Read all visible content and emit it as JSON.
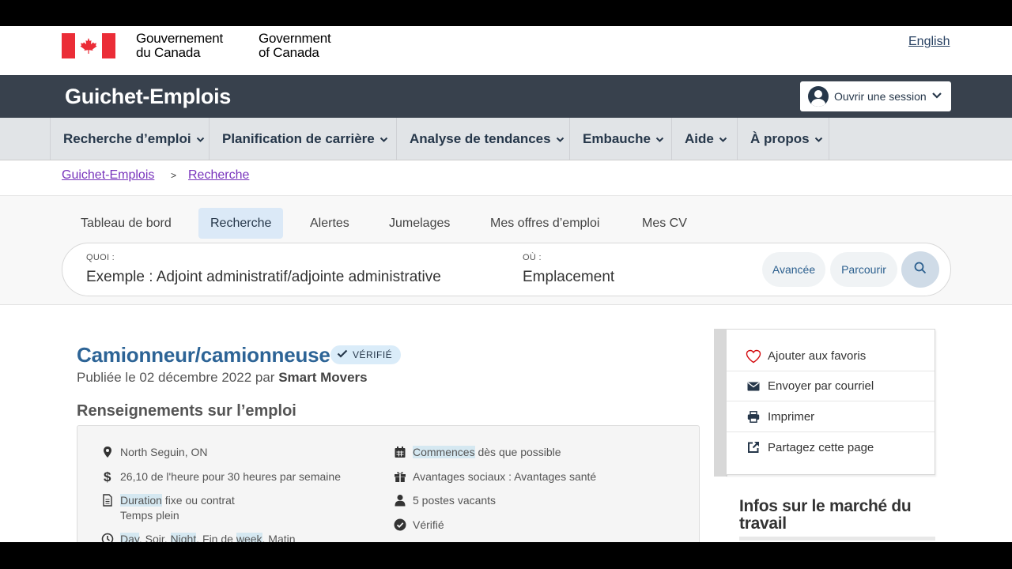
{
  "goc": {
    "name_fr_line1": "Gouvernement",
    "name_fr_line2": "du Canada",
    "name_en_line1": "Government",
    "name_en_line2": "of Canada",
    "language_link": "English"
  },
  "app": {
    "title": "Guichet-Emplois",
    "login_label": "Ouvrir une session"
  },
  "nav": {
    "items": [
      "Recherche d’emploi",
      "Planification de carrière",
      "Analyse de tendances",
      "Embauche",
      "Aide",
      "À propos"
    ]
  },
  "breadcrumb": {
    "items": [
      "Guichet-Emplois",
      "Recherche"
    ],
    "separator": ">"
  },
  "tabs": {
    "items": [
      "Tableau de bord",
      "Recherche",
      "Alertes",
      "Jumelages",
      "Mes offres d’emploi",
      "Mes CV"
    ],
    "active": "Recherche"
  },
  "search": {
    "what_label": "QUOI :",
    "what_placeholder": "Exemple : Adjoint administratif/adjointe administrative",
    "where_label": "OÙ :",
    "where_placeholder": "Emplacement",
    "advanced_label": "Avancée",
    "browse_label": "Parcourir"
  },
  "job": {
    "title": "Camionneur/camionneuse",
    "verified_badge": "VÉRIFIÉ",
    "published_prefix": "Publiée le 02 décembre 2022 par",
    "employer": "Smart Movers",
    "section_heading": "Renseignements sur l’emploi",
    "location": "North Seguin, ON",
    "salary": "26,10 de l'heure pour 30 heures par semaine",
    "duration_hl": "Duration",
    "duration_rest": " fixe ou contrat",
    "employment_type": "Temps plein",
    "schedule": {
      "day": "Day",
      "soir": ", Soir, ",
      "night": "Night",
      "finde": ", Fin de ",
      "week": "week",
      "matin": ", Matin"
    },
    "start_hl": "Commences",
    "start_rest": " dès que possible",
    "benefits": "Avantages sociaux : Avantages santé",
    "vacancies": "5 postes vacants",
    "verified": "Vérifié"
  },
  "sidebar": {
    "favorite": "Ajouter aux favoris",
    "email": "Envoyer par courriel",
    "print": "Imprimer",
    "share": "Partagez cette page",
    "lmi_title": "Infos sur le marché du travail"
  },
  "colors": {
    "header_dark": "#38414d",
    "nav_bg": "#e1e4e7",
    "link_visited": "#7834bc",
    "job_title_blue": "#2d6496",
    "flag_red": "#eb2d37"
  }
}
